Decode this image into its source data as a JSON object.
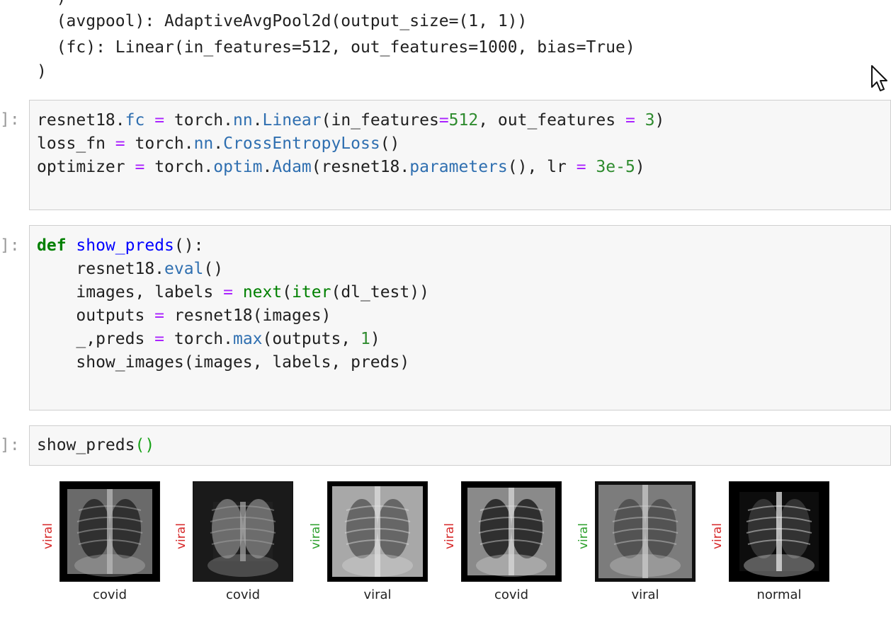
{
  "output": {
    "lines": [
      "  )",
      "  (avgpool): AdaptiveAvgPool2d(output_size=(1, 1))",
      "  (fc): Linear(in_features=512, out_features=1000, bias=True)",
      ")"
    ]
  },
  "cells": [
    {
      "prompt": "]:",
      "lines": [
        [
          [
            "resnet18.",
            "t"
          ],
          [
            "fc",
            "attr"
          ],
          [
            " ",
            "t"
          ],
          [
            "=",
            "op"
          ],
          [
            " torch.",
            "t"
          ],
          [
            "nn",
            "attr"
          ],
          [
            ".",
            "t"
          ],
          [
            "Linear",
            "attr"
          ],
          [
            "(in_features",
            "t"
          ],
          [
            "=",
            "op"
          ],
          [
            "512",
            "num"
          ],
          [
            ", out_features ",
            "t"
          ],
          [
            "=",
            "op"
          ],
          [
            " ",
            "t"
          ],
          [
            "3",
            "num"
          ],
          [
            ")",
            "t"
          ]
        ],
        [
          [
            "loss_fn ",
            "t"
          ],
          [
            "=",
            "op"
          ],
          [
            " torch.",
            "t"
          ],
          [
            "nn",
            "attr"
          ],
          [
            ".",
            "t"
          ],
          [
            "CrossEntropyLoss",
            "attr"
          ],
          [
            "()",
            "t"
          ]
        ],
        [
          [
            "optimizer ",
            "t"
          ],
          [
            "=",
            "op"
          ],
          [
            " torch.",
            "t"
          ],
          [
            "optim",
            "attr"
          ],
          [
            ".",
            "t"
          ],
          [
            "Adam",
            "attr"
          ],
          [
            "(resnet18.",
            "t"
          ],
          [
            "parameters",
            "attr"
          ],
          [
            "(), lr ",
            "t"
          ],
          [
            "=",
            "op"
          ],
          [
            " ",
            "t"
          ],
          [
            "3e-5",
            "num"
          ],
          [
            ")",
            "t"
          ]
        ]
      ]
    },
    {
      "prompt": "]:",
      "lines": [
        [
          [
            "def",
            "kw"
          ],
          [
            " ",
            "t"
          ],
          [
            "show_preds",
            "fn"
          ],
          [
            "():",
            "t"
          ]
        ],
        [
          [
            "    resnet18.",
            "t"
          ],
          [
            "eval",
            "attr"
          ],
          [
            "()",
            "t"
          ]
        ],
        [
          [
            "    images, labels ",
            "t"
          ],
          [
            "=",
            "op"
          ],
          [
            " ",
            "t"
          ],
          [
            "next",
            "bi"
          ],
          [
            "(",
            "t"
          ],
          [
            "iter",
            "bi"
          ],
          [
            "(dl_test))",
            "t"
          ]
        ],
        [
          [
            "    outputs ",
            "t"
          ],
          [
            "=",
            "op"
          ],
          [
            " resnet18(images)",
            "t"
          ]
        ],
        [
          [
            "    _,preds ",
            "t"
          ],
          [
            "=",
            "op"
          ],
          [
            " torch.",
            "t"
          ],
          [
            "max",
            "attr"
          ],
          [
            "(outputs, ",
            "t"
          ],
          [
            "1",
            "num"
          ],
          [
            ")",
            "t"
          ]
        ],
        [
          [
            "    show_images(images, labels, preds)",
            "t"
          ]
        ]
      ]
    },
    {
      "prompt": "]:",
      "lines": [
        [
          [
            "show_preds",
            "t"
          ],
          [
            "()",
            "pg"
          ]
        ]
      ]
    }
  ],
  "predictions": [
    {
      "true_label": "covid",
      "pred_label": "viral",
      "pred_color": "#d62728"
    },
    {
      "true_label": "covid",
      "pred_label": "viral",
      "pred_color": "#d62728"
    },
    {
      "true_label": "viral",
      "pred_label": "viral",
      "pred_color": "#2ca02c"
    },
    {
      "true_label": "covid",
      "pred_label": "viral",
      "pred_color": "#d62728"
    },
    {
      "true_label": "viral",
      "pred_label": "viral",
      "pred_color": "#2ca02c"
    },
    {
      "true_label": "normal",
      "pred_label": "viral",
      "pred_color": "#d62728"
    }
  ],
  "icons": {
    "cursor": "mouse-pointer-icon",
    "xray": "chest-xray-image"
  }
}
